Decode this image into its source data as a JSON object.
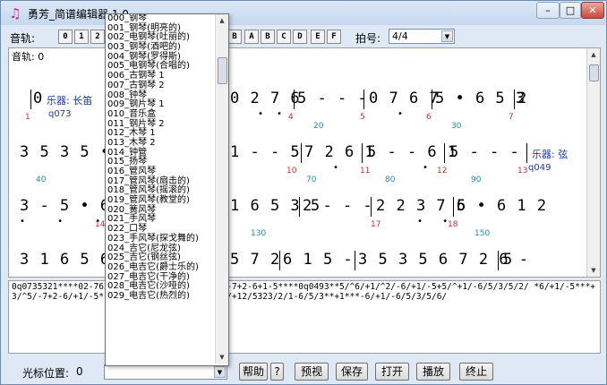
{
  "window": {
    "title": "勇芳_简谱编辑器 1.0",
    "minimize": "–",
    "maximize": "□",
    "close": "✕"
  },
  "toolbar": {
    "track_label": "音轨:",
    "track_buttons": [
      "0",
      "1",
      "2"
    ],
    "hex_buttons": [
      "B",
      "A",
      "B",
      "C",
      "D",
      "E",
      "F"
    ],
    "meter_label": "拍号:",
    "meter_value": "4/4"
  },
  "editor": {
    "track_text": "音轨: 0",
    "rows": [
      {
        "segments": [
          {
            "t": "0"
          },
          {
            "t": "0 2 7 6"
          },
          {
            "t": "5 - - -"
          },
          {
            "t": "0 7 6 7"
          },
          {
            "t": "5 • 6 5 3"
          },
          {
            "t": "2"
          }
        ],
        "instrument": "乐器: 长笛",
        "inst_code": "q073",
        "measure_nums": [
          "1",
          "4",
          "5",
          "6",
          "7"
        ],
        "tick_nums": [
          "20",
          "30"
        ]
      },
      {
        "segments": [
          {
            "t": "3 5 3 5 • 3"
          },
          {
            "t": "1 - - 5"
          },
          {
            "t": "7 2 6 1"
          },
          {
            "t": "5 - - 6 1"
          },
          {
            "t": "5 - - -"
          }
        ],
        "instrument": "乐器: 弦",
        "inst_code": "q049",
        "measure_nums": [
          "10",
          "11",
          "12",
          "13"
        ],
        "tick_nums": [
          "40",
          "70",
          "80",
          "90"
        ]
      },
      {
        "segments": [
          {
            "t": "3 - 5 • 6"
          },
          {
            "t": "1 6 5 3 5"
          },
          {
            "t": "2 - - -"
          },
          {
            "t": "2 2 3 7 6"
          },
          {
            "t": "5 • 6 1 2"
          }
        ],
        "measure_nums": [
          "14",
          "17",
          "18"
        ],
        "tick_nums": [
          "130",
          "150"
        ]
      },
      {
        "segments": [
          {
            "t": "3 1 6 5 6"
          },
          {
            "t": "5 7 2"
          },
          {
            "t": "6 1 5 -"
          },
          {
            "t": "3 5 3 5 6 7 2 6 -"
          },
          {
            "t": "5"
          }
        ],
        "measure_nums": [],
        "tick_nums": []
      }
    ]
  },
  "code_text": "0q0735321****02-765     /3/2/3/5/3/4/3/2/1***5-7+2-6+1-5****0q0493**5/^6/+1/^2/-6/+1/-5+5/^+1/-6/5/3/5/2/     *6/+1/-5***+3/^5/-7+2-6/+1/-5***3/5/3/5/6/7/+2/-6**5/6/+12/5323/2/1-6/5/3**+1***-6/+1/-6/5/3/5/6/",
  "dropdown": {
    "items": [
      "000_钢琴",
      "001_钢琴(明亮的)",
      "002_电钢琴(吐丽的)",
      "003_钢琴(酒吧的)",
      "004_钢琴(罗得斯)",
      "005_电钢琴(合唱的)",
      "006_古钢琴 1",
      "007_古钢琴 2",
      "008_钟琴",
      "009_钢片琴 1",
      "010_音乐盒",
      "011_钢片琴 2",
      "012_木琴 1",
      "013_木琴 2",
      "014_钟管",
      "015_扬琴",
      "016_管风琴",
      "017_管风琴(扇击的)",
      "018_管风琴(摇滚的)",
      "019_管风琴(教堂的)",
      "020_簧风琴",
      "021_手风琴",
      "022_口琴",
      "023_手风琴(探戈舞的)",
      "024_吉它(尼龙弦)",
      "025_吉它(钢丝弦)",
      "026_电吉它(爵士乐的)",
      "027_电吉它(干净的)",
      "028_电吉它(沙哑的)",
      "029_电吉它(热烈的)"
    ]
  },
  "status": {
    "cursor_label": "光标位置:",
    "cursor_value": "0",
    "help": "帮助",
    "question": "?",
    "preview": "预视",
    "save": "保存",
    "open": "打开",
    "play": "播放",
    "stop": "终止"
  }
}
